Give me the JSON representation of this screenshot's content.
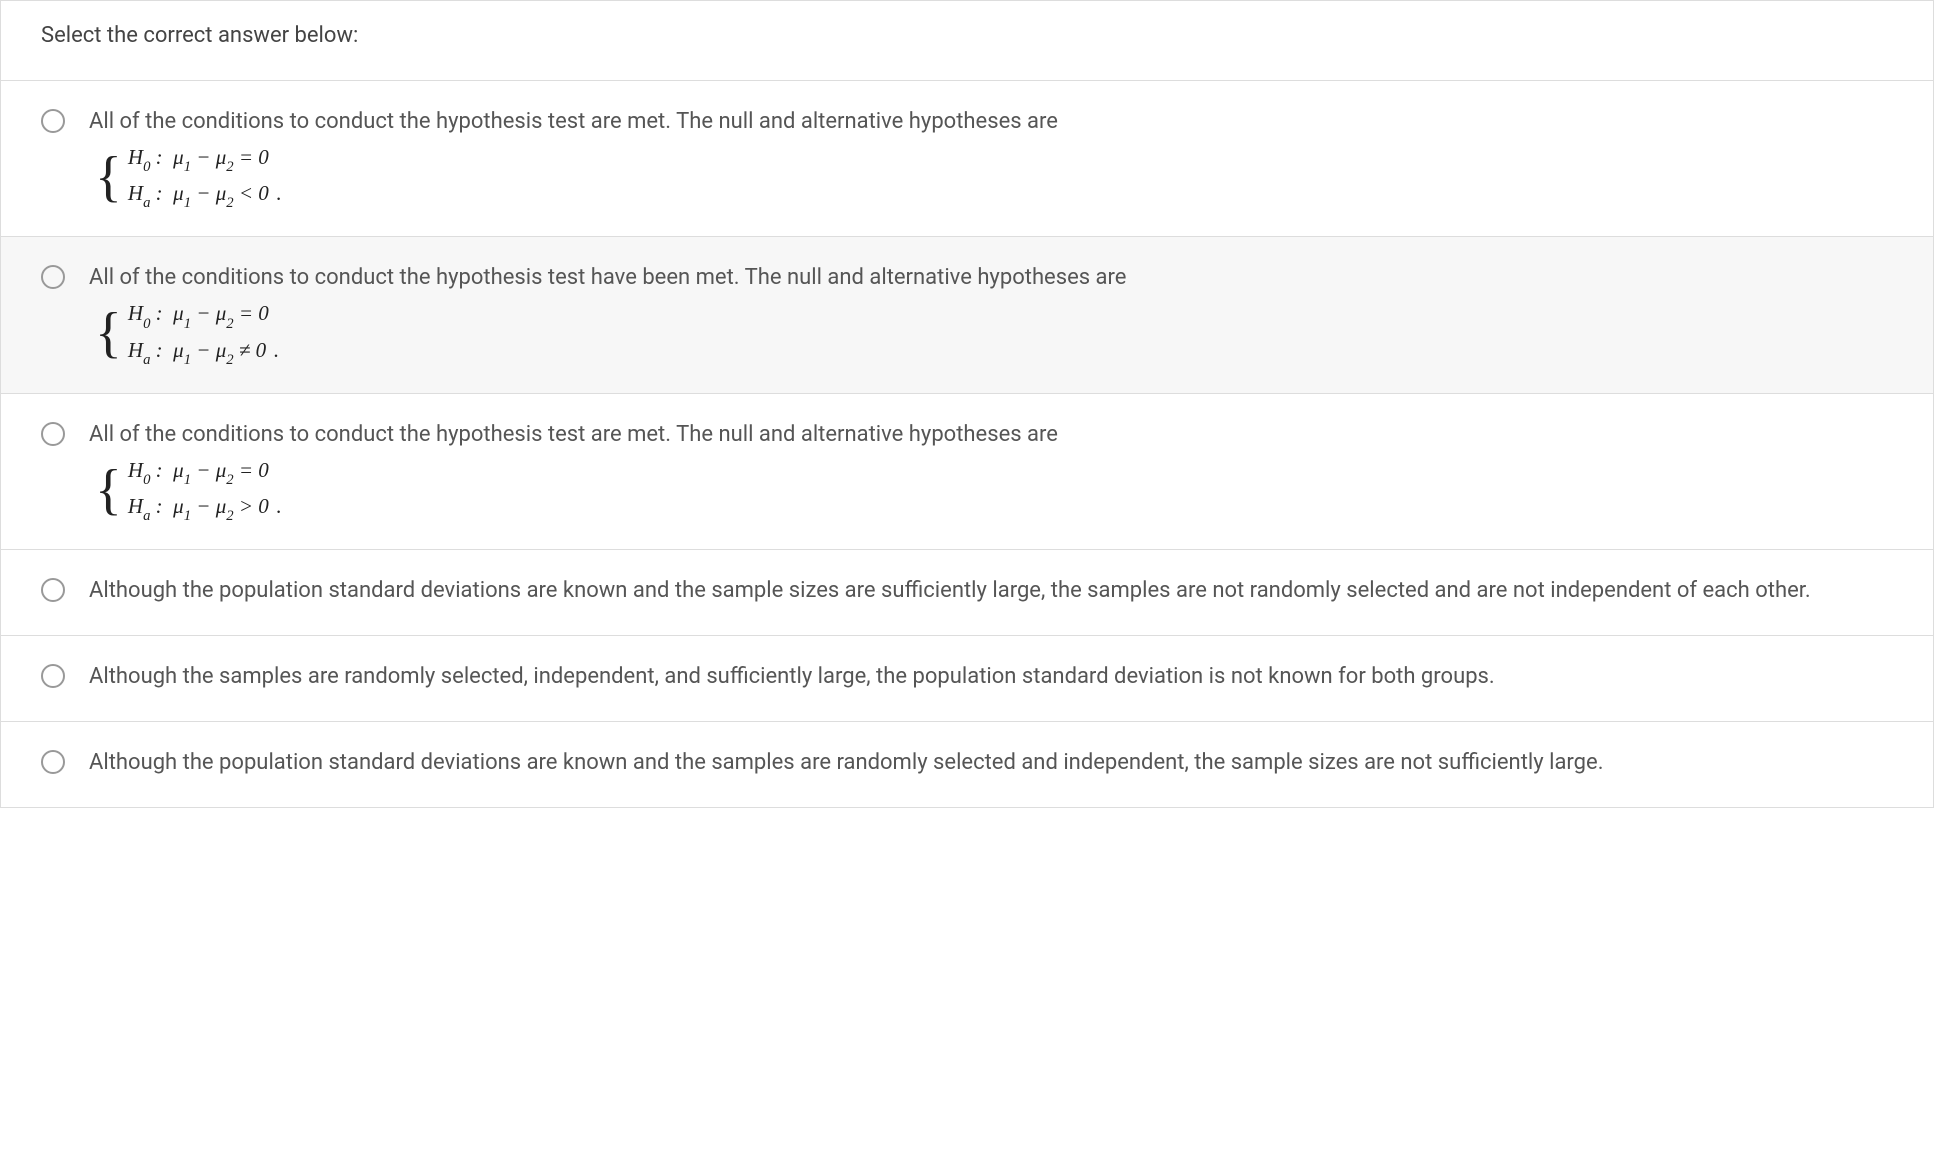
{
  "prompt": "Select the correct answer below:",
  "options": [
    {
      "text": "All of the conditions to conduct the hypothesis test are met. The null and alternative hypotheses are",
      "hasMath": true,
      "h0": "H₀ :  μ₁ − μ₂ = 0",
      "ha": "Hₐ :  μ₁ − μ₂ < 0",
      "grey": false
    },
    {
      "text": "All of the conditions to conduct the hypothesis test have been met. The null and alternative hypotheses are",
      "hasMath": true,
      "h0": "H₀ :  μ₁ − μ₂ = 0",
      "ha": "Hₐ :  μ₁ − μ₂ ≠ 0",
      "grey": true
    },
    {
      "text": "All of the conditions to conduct the hypothesis test are met. The null and alternative hypotheses are",
      "hasMath": true,
      "h0": "H₀ :  μ₁ − μ₂ = 0",
      "ha": "Hₐ :  μ₁ − μ₂ > 0",
      "grey": false
    },
    {
      "text": "Although the population standard deviations are known and the sample sizes are sufficiently large, the samples are not randomly selected and are not independent of each other.",
      "hasMath": false,
      "grey": false
    },
    {
      "text": "Although the samples are randomly selected, independent, and sufficiently large, the population standard deviation is not known for both groups.",
      "hasMath": false,
      "grey": false
    },
    {
      "text": "Although the population standard deviations are known and the samples are randomly selected and independent, the sample sizes are not sufficiently large.",
      "hasMath": false,
      "grey": false
    }
  ]
}
